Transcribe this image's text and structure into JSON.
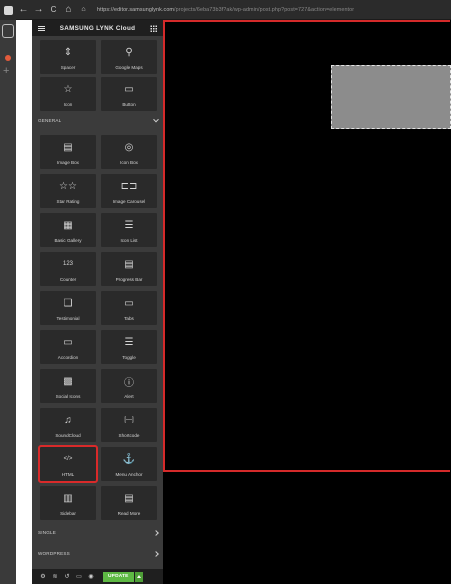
{
  "browser": {
    "url_domain": "https://editor.samsunglynk.com",
    "url_path": "/projects/6eba73b3f?ak/wp-admin/post.php?post=727&action=elementor",
    "back": "←",
    "forward": "→",
    "reload": "C",
    "home": "⌂"
  },
  "panel": {
    "title": "SAMSUNG LYNK Cloud",
    "sections": {
      "general": "GENERAL",
      "single": "SINGLE",
      "wordpress": "WORDPRESS"
    },
    "widgets_top": [
      {
        "label": "Spacer",
        "icon": "spacer-icon",
        "glyph": "⇕"
      },
      {
        "label": "Google Maps",
        "icon": "map-icon",
        "glyph": "⚲"
      },
      {
        "label": "Icon",
        "icon": "star-icon",
        "glyph": "☆"
      },
      {
        "label": "Button",
        "icon": "button-icon",
        "glyph": "▭"
      }
    ],
    "widgets_general": [
      {
        "label": "Image Box",
        "icon": "image-box-icon",
        "glyph": "▤"
      },
      {
        "label": "Icon Box",
        "icon": "icon-box-icon",
        "glyph": "◎"
      },
      {
        "label": "Star Rating",
        "icon": "star-rating-icon",
        "glyph": "☆☆"
      },
      {
        "label": "Image Carousel",
        "icon": "image-carousel-icon",
        "glyph": "⊏⊐"
      },
      {
        "label": "Basic Gallery",
        "icon": "gallery-icon",
        "glyph": "▦"
      },
      {
        "label": "Icon List",
        "icon": "icon-list-icon",
        "glyph": "☰"
      },
      {
        "label": "Counter",
        "icon": "counter-icon",
        "glyph": "123"
      },
      {
        "label": "Progress Bar",
        "icon": "progress-bar-icon",
        "glyph": "▤"
      },
      {
        "label": "Testimonial",
        "icon": "testimonial-icon",
        "glyph": "❑"
      },
      {
        "label": "Tabs",
        "icon": "tabs-icon",
        "glyph": "▭"
      },
      {
        "label": "Accordion",
        "icon": "accordion-icon",
        "glyph": "▭"
      },
      {
        "label": "Toggle",
        "icon": "toggle-icon",
        "glyph": "☰"
      },
      {
        "label": "Social Icons",
        "icon": "social-icons-icon",
        "glyph": "▩"
      },
      {
        "label": "Alert",
        "icon": "alert-icon",
        "glyph": "ⓘ"
      },
      {
        "label": "SoundCloud",
        "icon": "soundcloud-icon",
        "glyph": "♫"
      },
      {
        "label": "Shortcode",
        "icon": "shortcode-icon",
        "glyph": "[—]"
      },
      {
        "label": "HTML",
        "icon": "html-icon",
        "glyph": "</>"
      },
      {
        "label": "Menu Anchor",
        "icon": "anchor-icon",
        "glyph": "⚓"
      },
      {
        "label": "Sidebar",
        "icon": "sidebar-icon",
        "glyph": "▥"
      },
      {
        "label": "Read More",
        "icon": "read-more-icon",
        "glyph": "▤"
      }
    ],
    "footer": {
      "update_label": "UPDATE"
    }
  },
  "colors": {
    "panel_bg": "#3b3b3b",
    "tile_bg": "#2a2a2a",
    "highlight": "#d92a2a",
    "update_green": "#5eb944",
    "canvas_bg": "#000000"
  }
}
